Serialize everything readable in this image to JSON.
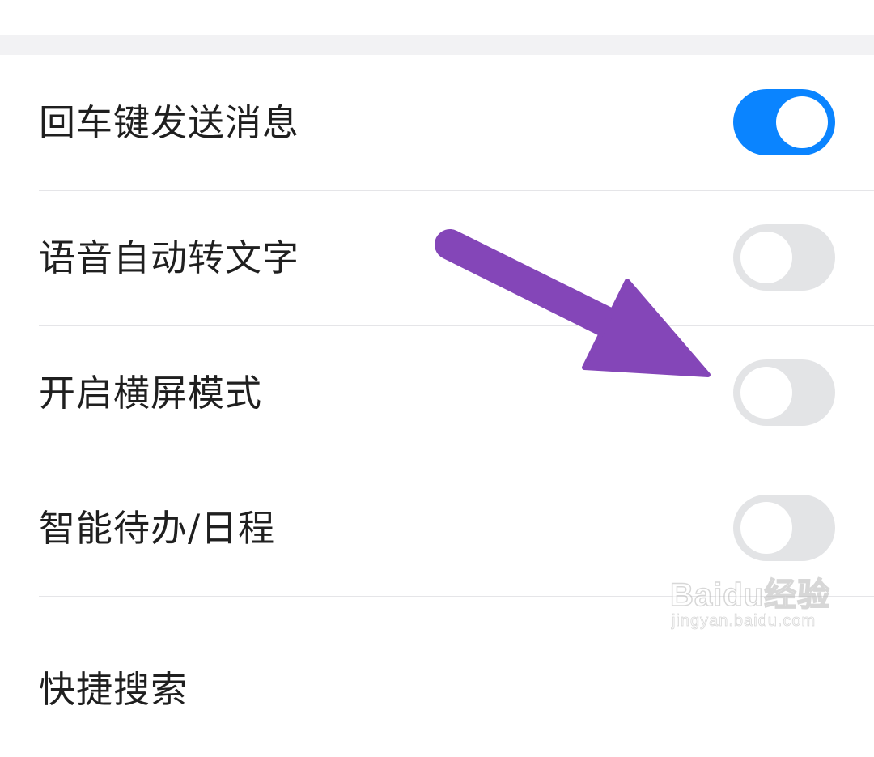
{
  "settings": [
    {
      "label": "回车键发送消息",
      "enabled": true
    },
    {
      "label": "语音自动转文字",
      "enabled": false
    },
    {
      "label": "开启横屏模式",
      "enabled": false
    },
    {
      "label": "智能待办/日程",
      "enabled": false
    },
    {
      "label": "快捷搜索",
      "enabled": null
    }
  ],
  "colors": {
    "toggle_on": "#0a84ff",
    "toggle_off": "#e3e4e6",
    "arrow": "#8446b8",
    "section_gap": "#f2f2f4"
  },
  "annotation": {
    "icon": "purple-arrow-icon"
  },
  "watermark": {
    "logo_text": "Baidu经验",
    "url_text": "jingyan.baidu.com"
  }
}
